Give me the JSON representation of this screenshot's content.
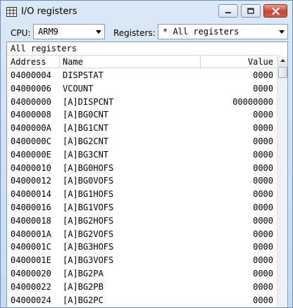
{
  "window": {
    "title": "I/O registers"
  },
  "toolbar": {
    "cpu_label": "CPU:",
    "cpu_value": "ARM9",
    "registers_label": "Registers:",
    "registers_value": "* All registers"
  },
  "list": {
    "title": "All registers",
    "columns": {
      "address": "Address",
      "name": "Name",
      "value": "Value"
    },
    "rows": [
      {
        "address": "04000004",
        "name": "DISPSTAT",
        "value": "0000"
      },
      {
        "address": "04000006",
        "name": "VCOUNT",
        "value": "0000"
      },
      {
        "address": "04000000",
        "name": "[A]DISPCNT",
        "value": "00000000"
      },
      {
        "address": "04000008",
        "name": "[A]BG0CNT",
        "value": "0000"
      },
      {
        "address": "0400000A",
        "name": "[A]BG1CNT",
        "value": "0000"
      },
      {
        "address": "0400000C",
        "name": "[A]BG2CNT",
        "value": "0000"
      },
      {
        "address": "0400000E",
        "name": "[A]BG3CNT",
        "value": "0000"
      },
      {
        "address": "04000010",
        "name": "[A]BG0HOFS",
        "value": "0000"
      },
      {
        "address": "04000012",
        "name": "[A]BG0VOFS",
        "value": "0000"
      },
      {
        "address": "04000014",
        "name": "[A]BG1HOFS",
        "value": "0000"
      },
      {
        "address": "04000016",
        "name": "[A]BG1VOFS",
        "value": "0000"
      },
      {
        "address": "04000018",
        "name": "[A]BG2HOFS",
        "value": "0000"
      },
      {
        "address": "0400001A",
        "name": "[A]BG2VOFS",
        "value": "0000"
      },
      {
        "address": "0400001C",
        "name": "[A]BG3HOFS",
        "value": "0000"
      },
      {
        "address": "0400001E",
        "name": "[A]BG3VOFS",
        "value": "0000"
      },
      {
        "address": "04000020",
        "name": "[A]BG2PA",
        "value": "0000"
      },
      {
        "address": "04000022",
        "name": "[A]BG2PB",
        "value": "0000"
      },
      {
        "address": "04000024",
        "name": "[A]BG2PC",
        "value": "0000"
      }
    ]
  },
  "icons": {
    "app": "grid-icon",
    "minimize": "minimize-icon",
    "maximize": "maximize-icon",
    "close": "close-icon",
    "dropdown": "chevron-down-icon",
    "scroll_up": "arrow-up-icon"
  }
}
